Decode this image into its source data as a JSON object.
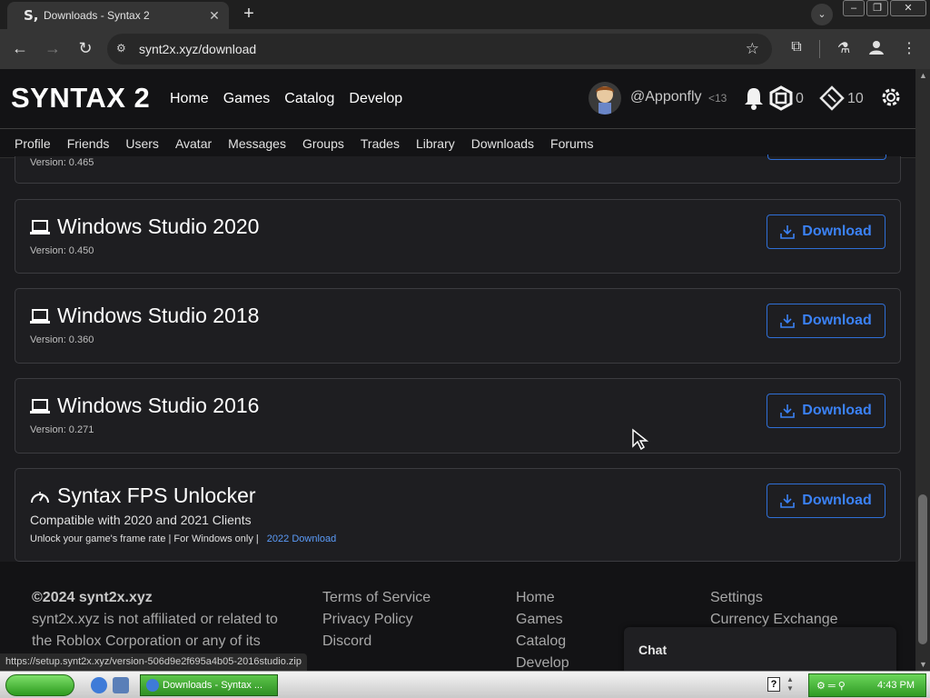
{
  "browser": {
    "tab_title": "Downloads - Syntax 2",
    "tab_favicon": "S,",
    "url": "synt2x.xyz/download",
    "status_url": "https://setup.synt2x.xyz/version-506d9e2f695a4b05-2016studio.zip"
  },
  "header": {
    "brand": "SYNTAX 2",
    "nav": [
      "Home",
      "Games",
      "Catalog",
      "Develop"
    ],
    "username": "@Apponfly",
    "level": "<13",
    "robux": "0",
    "tickets": "10"
  },
  "subnav": [
    "Profile",
    "Friends",
    "Users",
    "Avatar",
    "Messages",
    "Groups",
    "Trades",
    "Library",
    "Downloads",
    "Forums"
  ],
  "downloads": {
    "partial_version": "Version: 0.465",
    "items": [
      {
        "title": "Windows Studio 2020",
        "version": "Version: 0.450",
        "button": "Download"
      },
      {
        "title": "Windows Studio 2018",
        "version": "Version: 0.360",
        "button": "Download"
      },
      {
        "title": "Windows Studio 2016",
        "version": "Version: 0.271",
        "button": "Download"
      }
    ],
    "fps": {
      "title": "Syntax FPS Unlocker",
      "subtitle": "Compatible with 2020 and 2021 Clients",
      "desc": "Unlock your game's frame rate | For Windows only |",
      "link": "2022 Download",
      "button": "Download"
    }
  },
  "footer": {
    "copyright": "©2024 synt2x.xyz",
    "disclaimer_1": "synt2x.xyz is not affiliated or related to",
    "disclaimer_2": "the Roblox Corporation or any of its",
    "legal": [
      "Terms of Service",
      "Privacy Policy",
      "Discord"
    ],
    "nav": [
      "Home",
      "Games",
      "Catalog",
      "Develop"
    ],
    "account": [
      "Settings",
      "Currency Exchange"
    ]
  },
  "chat": {
    "label": "Chat"
  },
  "taskbar": {
    "task_label": "Downloads - Syntax ...",
    "time": "4:43 PM",
    "help": "?"
  },
  "colors": {
    "accent_blue": "#3b82f6",
    "page_bg": "#1b1b1e",
    "header_bg": "#131315",
    "card_border": "#3c3c40"
  }
}
